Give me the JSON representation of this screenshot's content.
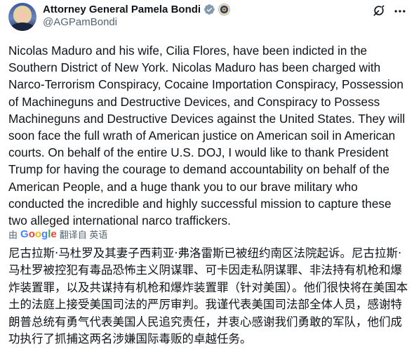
{
  "author": {
    "display_name": "Attorney General Pamela Bondi",
    "handle": "@AGPamBondi"
  },
  "colors": {
    "verified": "#829aab",
    "secondary_text": "#536471",
    "primary_text": "#0f1419"
  },
  "icons": {
    "verified": "verified-badge-icon",
    "affiliation": "doj-seal-icon",
    "grok": "grok-icon",
    "more": "more-icon"
  },
  "tweet": {
    "text": "Nicolas Maduro and his wife, Cilia Flores, have been indicted in the Southern District of New York.  Nicolas Maduro has been charged with Narco-Terrorism Conspiracy, Cocaine Importation Conspiracy, Possession of Machineguns and Destructive Devices, and Conspiracy to Possess Machineguns and Destructive Devices against the United States.  They will soon face the full wrath of American justice on American soil in American courts. On behalf of the entire U.S. DOJ, I would like to thank President Trump for having the courage to demand accountability on behalf of the American People, and a huge thank you to our brave military who conducted the incredible and highly successful mission to capture these two alleged international narco traffickers."
  },
  "translation": {
    "by_label": "由",
    "provider": "Google",
    "translated_from": "翻译自 英语",
    "text": "尼古拉斯·马杜罗及其妻子西莉亚·弗洛雷斯已被纽约南区法院起诉。尼古拉斯·马杜罗被控犯有毒品恐怖主义阴谋罪、可卡因走私阴谋罪、非法持有机枪和爆炸装置罪，以及共谋持有机枪和爆炸装置罪（针对美国）。他们很快将在美国本土的法庭上接受美国司法的严厉审判。我谨代表美国司法部全体人员，感谢特朗普总统有勇气代表美国人民追究责任，并衷心感谢我们勇敢的军队，他们成功执行了抓捕这两名涉嫌国际毒贩的卓越任务。"
  }
}
